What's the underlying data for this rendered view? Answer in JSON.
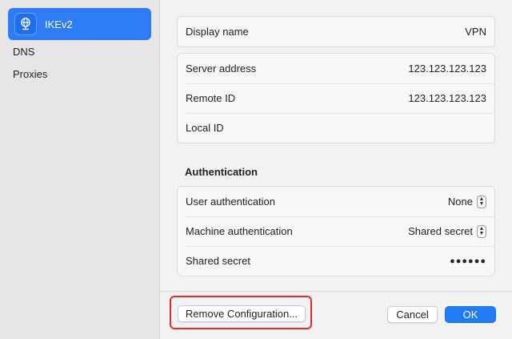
{
  "sidebar": {
    "items": [
      {
        "label": "IKEv2",
        "icon": "globe-network-icon",
        "selected": true
      },
      {
        "label": "DNS"
      },
      {
        "label": "Proxies"
      }
    ]
  },
  "general": {
    "display_name_label": "Display name",
    "display_name_value": "VPN"
  },
  "server": {
    "server_address_label": "Server address",
    "server_address_value": "123.123.123.123",
    "remote_id_label": "Remote ID",
    "remote_id_value": "123.123.123.123",
    "local_id_label": "Local ID",
    "local_id_value": ""
  },
  "authentication": {
    "title": "Authentication",
    "user_auth_label": "User authentication",
    "user_auth_value": "None",
    "machine_auth_label": "Machine authentication",
    "machine_auth_value": "Shared secret",
    "shared_secret_label": "Shared secret",
    "shared_secret_value": "●●●●●●"
  },
  "footer": {
    "remove_label": "Remove Configuration...",
    "cancel_label": "Cancel",
    "ok_label": "OK"
  },
  "colors": {
    "accent": "#1f7cf5",
    "highlight": "#e52b2b"
  }
}
